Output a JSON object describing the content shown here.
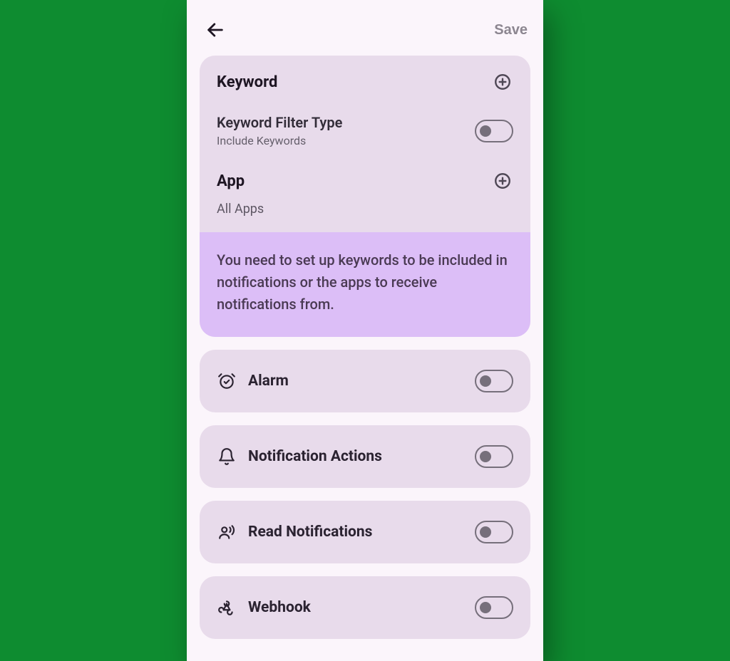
{
  "header": {
    "save_label": "Save"
  },
  "keyword_section": {
    "title": "Keyword",
    "filter_title": "Keyword Filter Type",
    "filter_desc": "Include Keywords"
  },
  "app_section": {
    "title": "App",
    "value": "All Apps"
  },
  "info": {
    "text": "You need to set up keywords to be included in notifications or the apps to receive notifications from."
  },
  "rows": [
    {
      "label": "Alarm"
    },
    {
      "label": "Notification Actions"
    },
    {
      "label": "Read Notifications"
    },
    {
      "label": "Webhook"
    }
  ]
}
